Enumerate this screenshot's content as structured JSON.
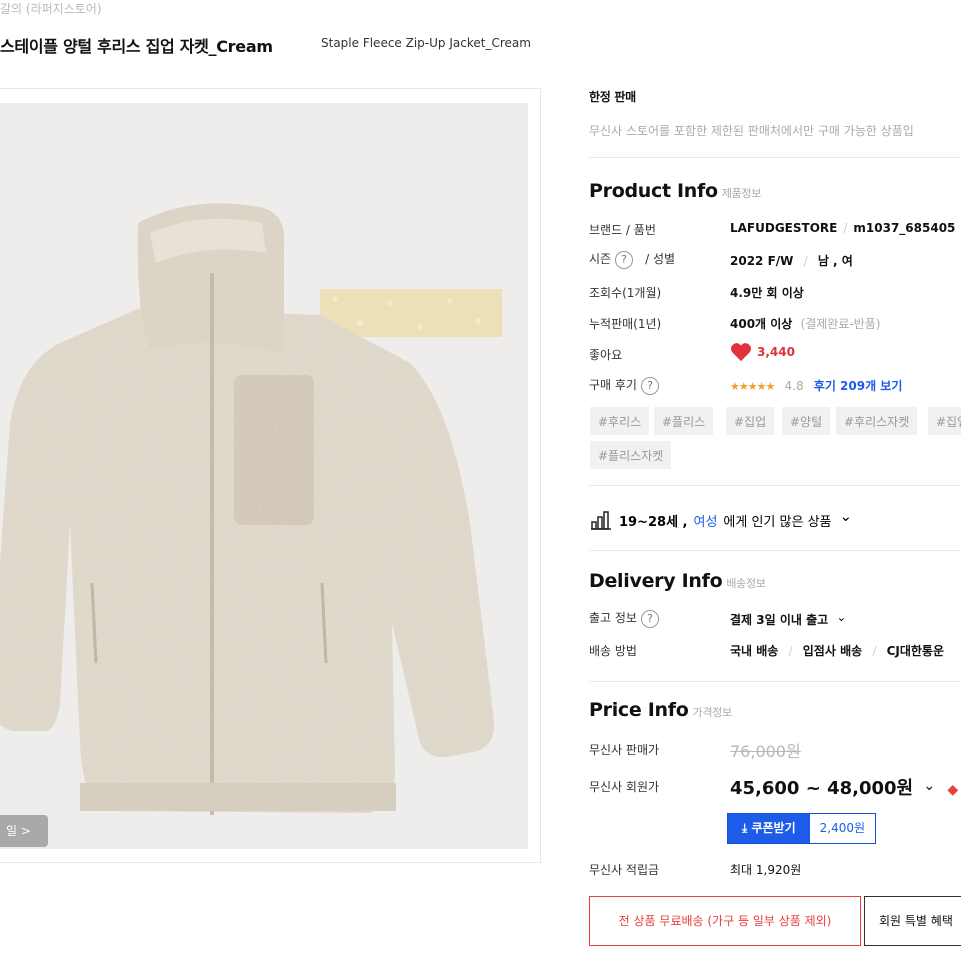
{
  "breadcrumb": "갈의 (라퍼지스토어)",
  "product": {
    "title_ko": "스테이플 양털 후리스 집업 자켓_Cream",
    "title_en": "Staple Fleece Zip-Up Jacket_Cream",
    "image_alt": "Cream fleece zip-up jacket",
    "image_badge": "일 >"
  },
  "limited": {
    "title": "한정 판매",
    "desc": "무신사 스토어를 포함한 제한된 판매처에서만 구매 가능한 상품입"
  },
  "product_info": {
    "title": "Product Info",
    "sub": "제품정보",
    "rows": {
      "brand_label": "브랜드 / 품번",
      "brand_name": "LAFUDGESTORE",
      "brand_sep": "/",
      "sku": "m1037_685405",
      "season_label": "시즌",
      "season_q": "?",
      "gender_label": "/ 성별",
      "season": "2022 F/W",
      "gender": "남 , 여",
      "views_label": "조회수(1개월)",
      "views": "4.9만 회 이상",
      "sales_label": "누적판매(1년)",
      "sales": "400개 이상",
      "sales_note": "(결제완료-반품)",
      "likes_label": "좋아요",
      "likes_icon": "heart-icon",
      "likes": "3,440",
      "review_label": "구매 후기",
      "review_q": "?",
      "stars": "★★★★★",
      "rating": "4.8",
      "review_link": "후기 209개 보기"
    },
    "tags": [
      "#후리스",
      "#플리스",
      "#집업",
      "#양털",
      "#후리스자켓",
      "#집업",
      "#플리스자켓"
    ]
  },
  "popular": {
    "icon": "bar-chart-icon",
    "age": "19~28세 ,",
    "gender": "여성",
    "text": "에게 인기 많은 상품",
    "chevron": "⌄"
  },
  "delivery_info": {
    "title": "Delivery Info",
    "sub": "배송정보",
    "ship_label": "출고 정보",
    "ship_q": "?",
    "ship_value": "결제 3일 이내 출고",
    "method_label": "배송 방법",
    "method_1": "국내 배송",
    "method_2": "입점사 배송",
    "method_3": "CJ대한통운"
  },
  "price_info": {
    "title": "Price Info",
    "sub": "가격정보",
    "sale_label": "무신사 판매가",
    "sale_price": "76,000원",
    "member_label": "무신사 회원가",
    "member_price": "45,600 ~ 48,000원",
    "member_chevron": "⌄",
    "coupon_btn": "⤓ 쿠폰받기",
    "coupon_amount": "2,400원",
    "points_label": "무신사 적립금",
    "points_value": "최대 1,920원"
  },
  "benefits": {
    "free_shipping": "전 상품 무료배송 (가구 등 일부 상품 제외)",
    "member_benefit": "회원 특별 혜택"
  },
  "colors": {
    "accent_blue": "#1c5ce8",
    "red": "#e84040",
    "heart": "#e0323c",
    "star": "#f0a030"
  }
}
